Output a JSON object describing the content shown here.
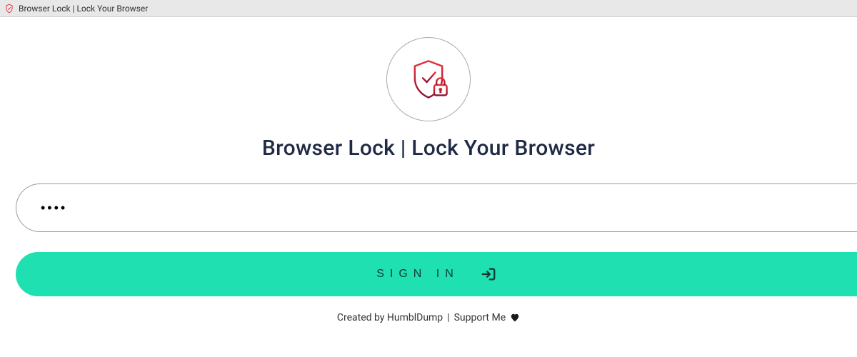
{
  "window": {
    "title": "Browser Lock | Lock Your Browser"
  },
  "main": {
    "heading": "Browser Lock | Lock Your Browser",
    "password_value": "••••",
    "password_placeholder": "",
    "signin_label": "SIGN IN"
  },
  "footer": {
    "created_by": "Created by HumblDump",
    "separator": " | ",
    "support_me": "Support Me"
  },
  "colors": {
    "accent": "#1fe0b0",
    "logo_red_light": "#e9313a",
    "logo_red_dark": "#8b1230",
    "text_dark": "#1f2a44"
  }
}
